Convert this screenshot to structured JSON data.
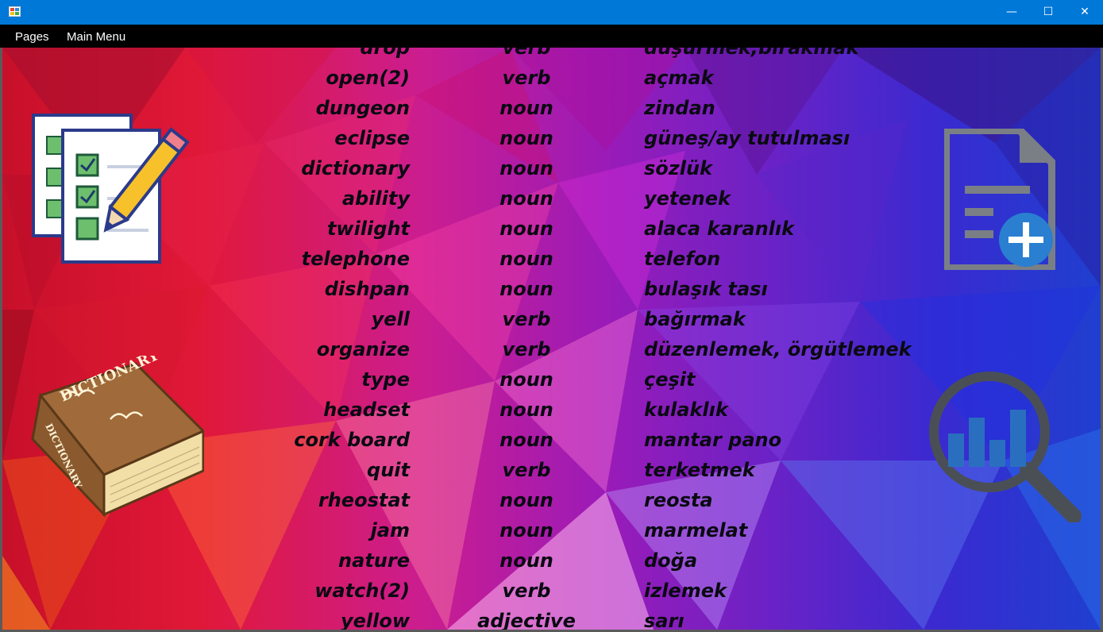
{
  "window": {
    "title": "",
    "minimize": "—",
    "maximize": "☐",
    "close": "✕"
  },
  "menu": [
    {
      "label": "Pages"
    },
    {
      "label": "Main Menu"
    }
  ],
  "icons": {
    "checklist": "checklist-pencil-icon",
    "dictionary": "dictionary-book-icon",
    "add_document": "add-document-icon",
    "search_stats": "search-statistics-icon"
  },
  "dictionary_book": {
    "cover_text": "DICTIONARY",
    "spine_text": "DICTIONARY"
  },
  "colors": {
    "titlebar": "#0078d7",
    "menubar": "#000000",
    "text": "#0a0a12"
  },
  "words": [
    {
      "word": "drop",
      "type": "verb",
      "translation": "düşürmek,bırakmak"
    },
    {
      "word": "open(2)",
      "type": "verb",
      "translation": "açmak"
    },
    {
      "word": "dungeon",
      "type": "noun",
      "translation": "zindan"
    },
    {
      "word": "eclipse",
      "type": "noun",
      "translation": "güneş/ay tutulması"
    },
    {
      "word": "dictionary",
      "type": "noun",
      "translation": "sözlük"
    },
    {
      "word": "ability",
      "type": "noun",
      "translation": "yetenek"
    },
    {
      "word": "twilight",
      "type": "noun",
      "translation": "alaca karanlık"
    },
    {
      "word": "telephone",
      "type": "noun",
      "translation": "telefon"
    },
    {
      "word": "dishpan",
      "type": "noun",
      "translation": "bulaşık tası"
    },
    {
      "word": "yell",
      "type": "verb",
      "translation": "bağırmak"
    },
    {
      "word": "organize",
      "type": "verb",
      "translation": "düzenlemek, örgütlemek"
    },
    {
      "word": "type",
      "type": "noun",
      "translation": "çeşit"
    },
    {
      "word": "headset",
      "type": "noun",
      "translation": "kulaklık"
    },
    {
      "word": "cork board",
      "type": "noun",
      "translation": "mantar pano"
    },
    {
      "word": "quit",
      "type": "verb",
      "translation": "terketmek"
    },
    {
      "word": "rheostat",
      "type": "noun",
      "translation": "reosta"
    },
    {
      "word": "jam",
      "type": "noun",
      "translation": "marmelat"
    },
    {
      "word": "nature",
      "type": "noun",
      "translation": "doğa"
    },
    {
      "word": "watch(2)",
      "type": "verb",
      "translation": "izlemek"
    },
    {
      "word": "yellow",
      "type": "adjective",
      "translation": "sarı"
    }
  ]
}
